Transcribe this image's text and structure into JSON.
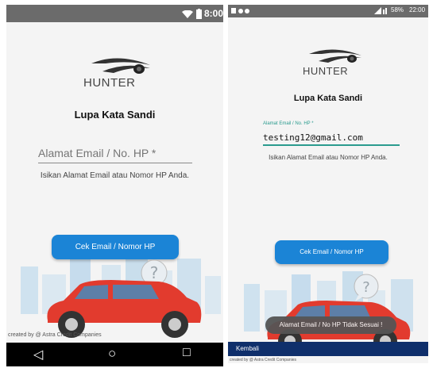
{
  "screen1": {
    "status": {
      "time": "8:00"
    },
    "logo": {
      "brand": "HUNTER"
    },
    "title": "Lupa Kata Sandi",
    "email_field": {
      "placeholder": "Alamat Email / No. HP *",
      "value": ""
    },
    "helper_text": "Isikan Alamat Email atau Nomor HP Anda.",
    "check_button": "Cek Email / Nomor HP",
    "credit": "created by @ Astra Credit Companies",
    "navbar": {
      "back": "◁",
      "home": "○",
      "recent": "□"
    }
  },
  "screen2": {
    "status": {
      "battery": "58%",
      "time": "22:00"
    },
    "logo": {
      "brand": "HUNTER"
    },
    "title": "Lupa Kata Sandi",
    "email_field": {
      "label": "Alamat Email / No. HP *",
      "value": "testing12@gmail.com"
    },
    "helper_text": "Isikan Alamat Email atau Nomor HP Anda.",
    "check_button": "Cek Email / Nomor HP",
    "toast": "Alamat Email / No HP Tidak Sesuai !",
    "back_button": "Kembali",
    "credit": "created by @ Astra Credit Companies"
  },
  "colors": {
    "accent": "#1b84d6",
    "car": "#e23b2e",
    "status_bar": "#6b6b6b"
  }
}
